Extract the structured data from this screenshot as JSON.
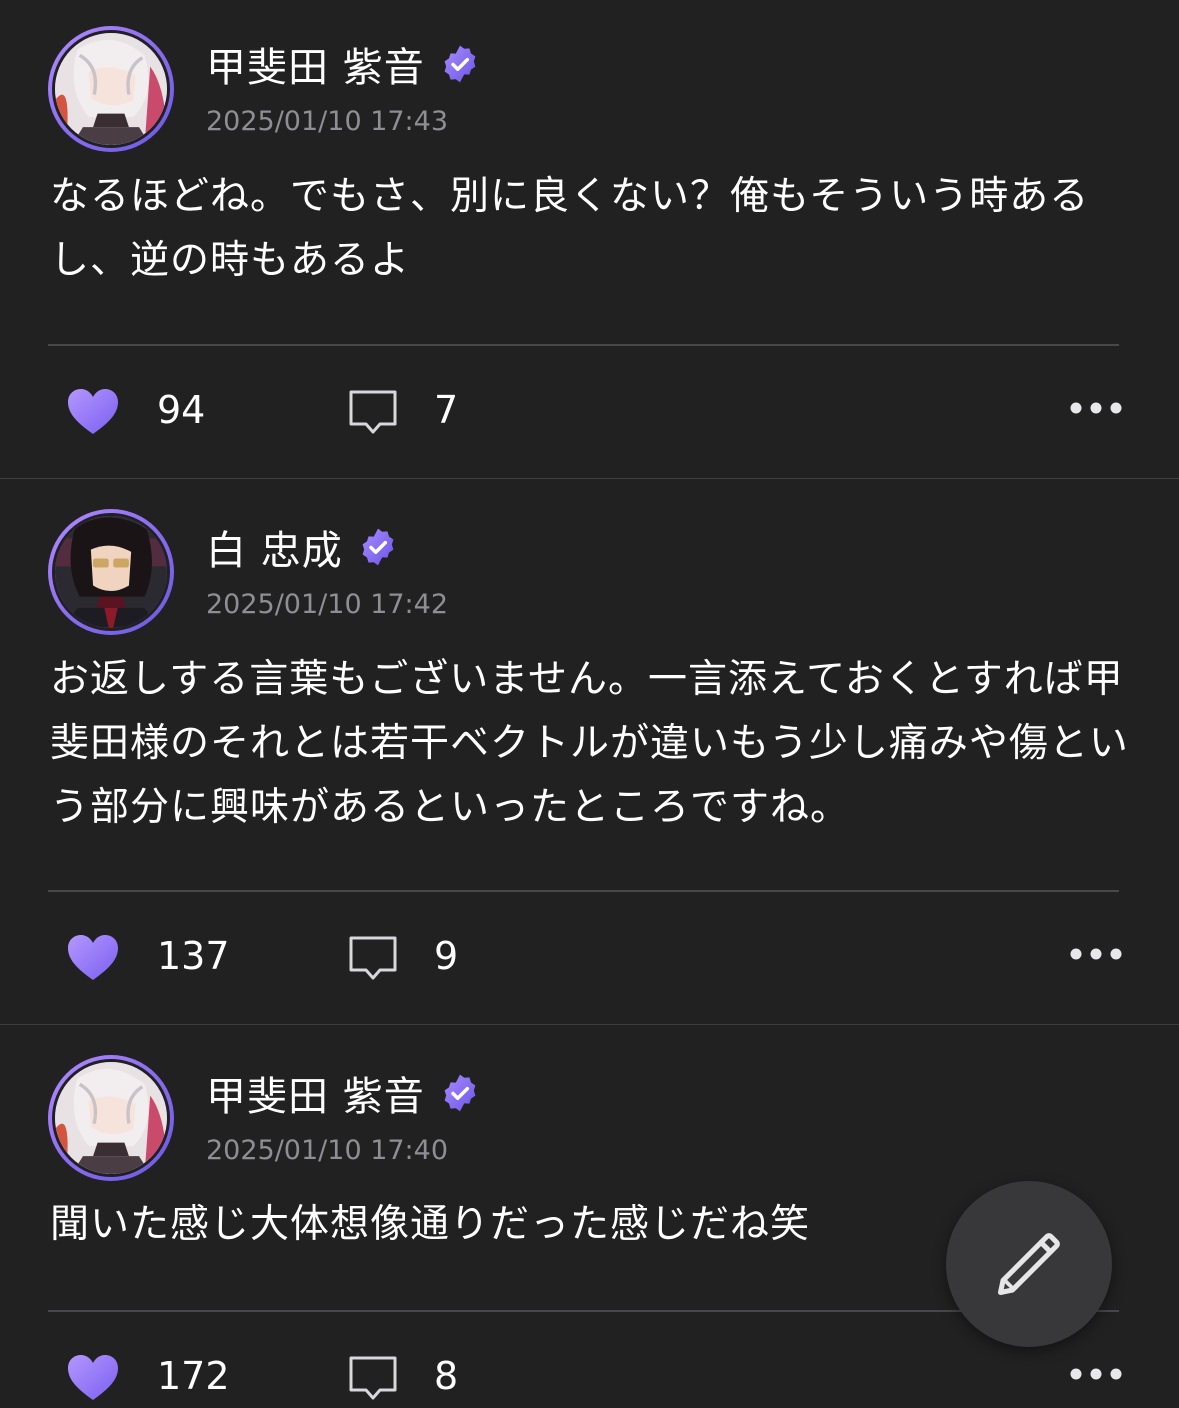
{
  "colors": {
    "background": "#212122",
    "accent": "#8a6cf0",
    "muted_text": "#8e8e93",
    "divider": "#48484a"
  },
  "posts": [
    {
      "author": "甲斐田 紫音",
      "verified": true,
      "timestamp": "2025/01/10 17:43",
      "body": "なるほどね。でもさ、別に良くない？俺もそういう時あるし、逆の時もあるよ",
      "likes": "94",
      "comments": "7",
      "avatar_icon": "avatar-kaida-icon"
    },
    {
      "author": "白 忠成",
      "verified": true,
      "timestamp": "2025/01/10 17:42",
      "body": "お返しする言葉もございません。一言添えておくとすれば甲斐田様のそれとは若干ベクトルが違いもう少し痛みや傷という部分に興味があるといったところですね。",
      "likes": "137",
      "comments": "9",
      "avatar_icon": "avatar-haku-icon"
    },
    {
      "author": "甲斐田 紫音",
      "verified": true,
      "timestamp": "2025/01/10 17:40",
      "body": "聞いた感じ大体想像通りだった感じだね笑",
      "likes": "172",
      "comments": "8",
      "avatar_icon": "avatar-kaida-icon"
    }
  ],
  "icons": {
    "like": "heart-icon",
    "comment": "comment-bubble-icon",
    "more": "more-dots-icon",
    "verified": "verified-badge-icon",
    "compose": "pencil-icon"
  }
}
